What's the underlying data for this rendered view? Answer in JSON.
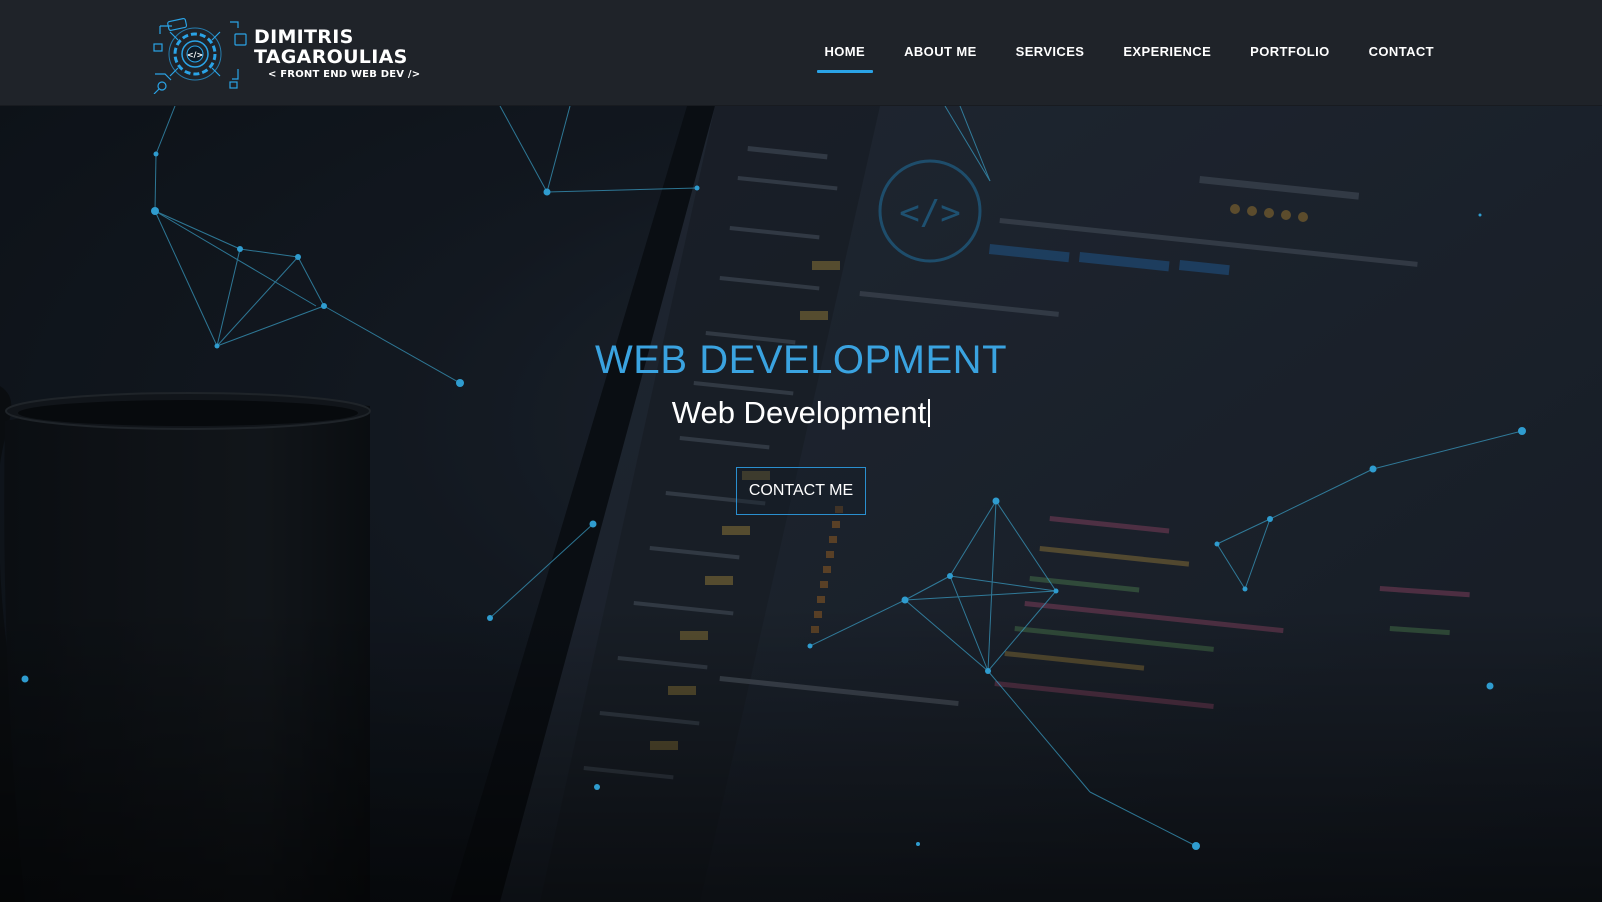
{
  "brand": {
    "name_line1": "DIMITRIS",
    "name_line2": "TAGAROULIAS",
    "tagline": "< FRONT END WEB DEV />"
  },
  "nav": {
    "items": [
      {
        "label": "HOME",
        "active": true
      },
      {
        "label": "ABOUT ME",
        "active": false
      },
      {
        "label": "SERVICES",
        "active": false
      },
      {
        "label": "EXPERIENCE",
        "active": false
      },
      {
        "label": "PORTFOLIO",
        "active": false
      },
      {
        "label": "CONTACT",
        "active": false
      }
    ]
  },
  "hero": {
    "title": "WEB DEVELOPMENT",
    "subtitle": "Web Development",
    "cta_label": "CONTACT ME",
    "background_photo": "laptop-code-editor-coffee-mug"
  },
  "colors": {
    "accent": "#2aa3e6",
    "header_bg": "#1f2329",
    "hero_title": "#3aa3e0"
  }
}
